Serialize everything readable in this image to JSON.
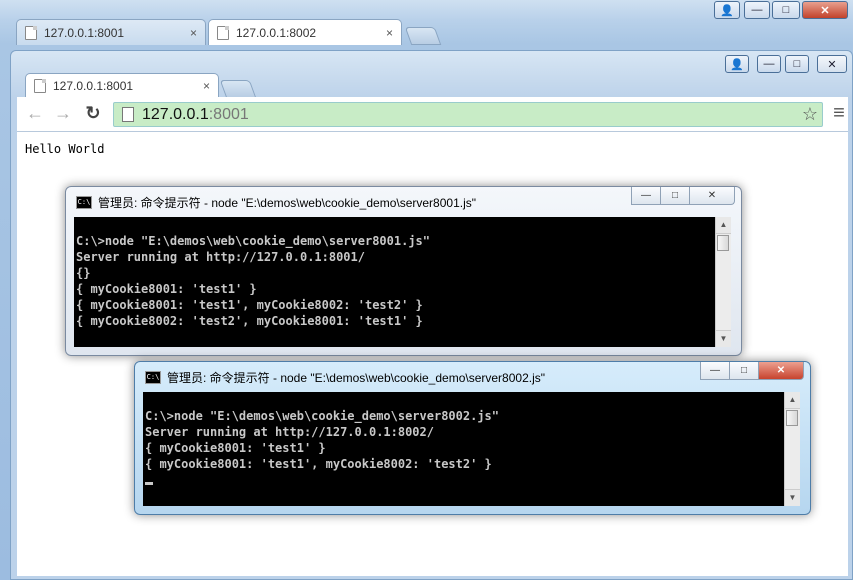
{
  "back_window": {
    "tabs": [
      {
        "label": "127.0.0.1:8001",
        "close": "×"
      },
      {
        "label": "127.0.0.1:8002",
        "close": "×"
      }
    ],
    "controls": {
      "user": "👤",
      "minimize": "—",
      "maximize": "□",
      "close": "✕"
    }
  },
  "front_window": {
    "tabs": [
      {
        "label": "127.0.0.1:8001",
        "close": "×"
      }
    ],
    "controls": {
      "user": "👤",
      "minimize": "—",
      "maximize": "□",
      "close": "✕"
    },
    "toolbar": {
      "back": "←",
      "forward": "→",
      "reload": "↻",
      "star": "☆",
      "menu": "≡"
    },
    "url": {
      "host": "127.0.0.1",
      "port": ":8001"
    },
    "page_text": "Hello World"
  },
  "console1": {
    "title": "管理员: 命令提示符 - node  \"E:\\demos\\web\\cookie_demo\\server8001.js\"",
    "lines": [
      "",
      "C:\\>node \"E:\\demos\\web\\cookie_demo\\server8001.js\"",
      "Server running at http://127.0.0.1:8001/",
      "{}",
      "{ myCookie8001: 'test1' }",
      "{ myCookie8001: 'test1', myCookie8002: 'test2' }",
      "{ myCookie8002: 'test2', myCookie8001: 'test1' }"
    ]
  },
  "console2": {
    "title": "管理员: 命令提示符 - node  \"E:\\demos\\web\\cookie_demo\\server8002.js\"",
    "lines": [
      "",
      "C:\\>node \"E:\\demos\\web\\cookie_demo\\server8002.js\"",
      "Server running at http://127.0.0.1:8002/",
      "{ myCookie8001: 'test1' }",
      "{ myCookie8001: 'test1', myCookie8002: 'test2' }"
    ]
  },
  "console_controls": {
    "minimize": "—",
    "maximize": "□",
    "close": "✕",
    "scroll_up": "▲",
    "scroll_down": "▼"
  }
}
